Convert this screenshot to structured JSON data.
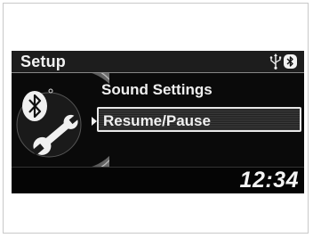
{
  "screen": {
    "title": "Setup",
    "status_icons": [
      "usb-icon",
      "bluetooth-icon"
    ]
  },
  "menu": {
    "items": [
      {
        "label": "Sound Settings",
        "selected": false
      },
      {
        "label": "Resume/Pause",
        "selected": true
      }
    ]
  },
  "clock": {
    "time": "12:34"
  },
  "colors": {
    "screen_bg": "#0a0a0a",
    "text": "#f0f0f0",
    "highlight_border": "#e8e8e8"
  }
}
